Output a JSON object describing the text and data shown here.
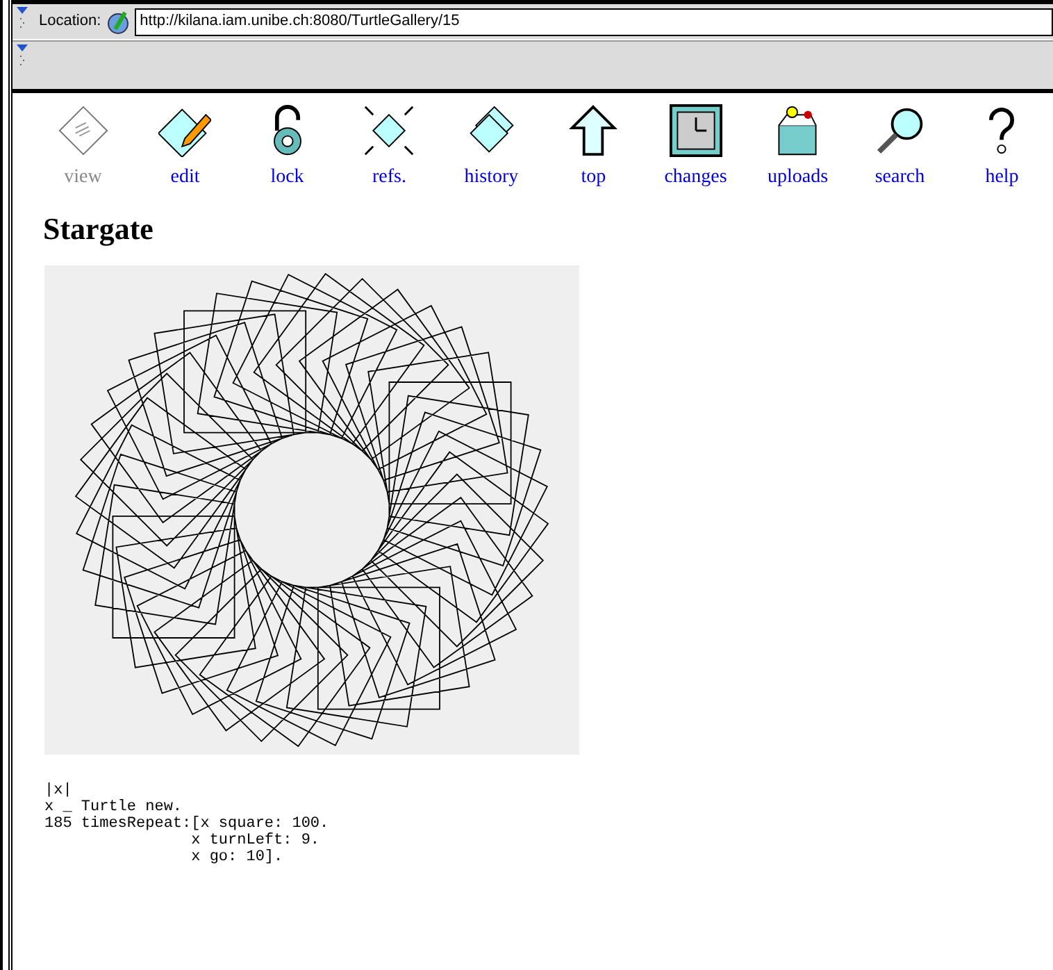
{
  "location_bar": {
    "label": "Location:",
    "url": "http://kilana.iam.unibe.ch:8080/TurtleGallery/15"
  },
  "toolbar": [
    {
      "kind": "view",
      "label": "view",
      "disabled": true
    },
    {
      "kind": "edit",
      "label": "edit",
      "disabled": false
    },
    {
      "kind": "lock",
      "label": "lock",
      "disabled": false
    },
    {
      "kind": "refs",
      "label": "refs.",
      "disabled": false
    },
    {
      "kind": "history",
      "label": "history",
      "disabled": false
    },
    {
      "kind": "top",
      "label": "top",
      "disabled": false
    },
    {
      "kind": "changes",
      "label": "changes",
      "disabled": false
    },
    {
      "kind": "uploads",
      "label": "uploads",
      "disabled": false
    },
    {
      "kind": "search",
      "label": "search",
      "disabled": false
    },
    {
      "kind": "help",
      "label": "help",
      "disabled": false
    }
  ],
  "page": {
    "title": "Stargate",
    "code_lines": [
      "|x|",
      "x _ Turtle new.",
      "185 timesRepeat:[x square: 100.",
      "                x turnLeft: 9.",
      "                x go: 10]."
    ]
  }
}
